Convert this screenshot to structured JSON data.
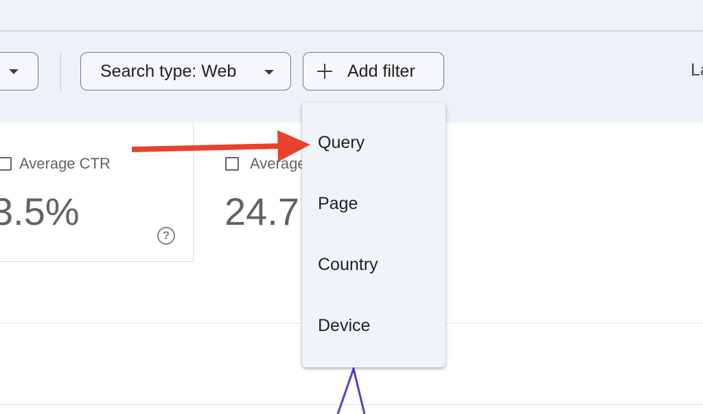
{
  "filters": {
    "search_type_label": "Search type: Web",
    "add_filter_label": "Add filter",
    "truncated_right_text": "La"
  },
  "metrics": [
    {
      "label": "Average CTR",
      "value": "3.5%",
      "has_help": true
    },
    {
      "label": "Average",
      "value": "24.7"
    }
  ],
  "help_glyph": "?",
  "dropdown": {
    "items": [
      {
        "label": "Query"
      },
      {
        "label": "Page"
      },
      {
        "label": "Country"
      },
      {
        "label": "Device"
      }
    ]
  },
  "annotation": {
    "color": "#e8422c",
    "target": "Query"
  },
  "chart_line_color": "#5b3cc4"
}
